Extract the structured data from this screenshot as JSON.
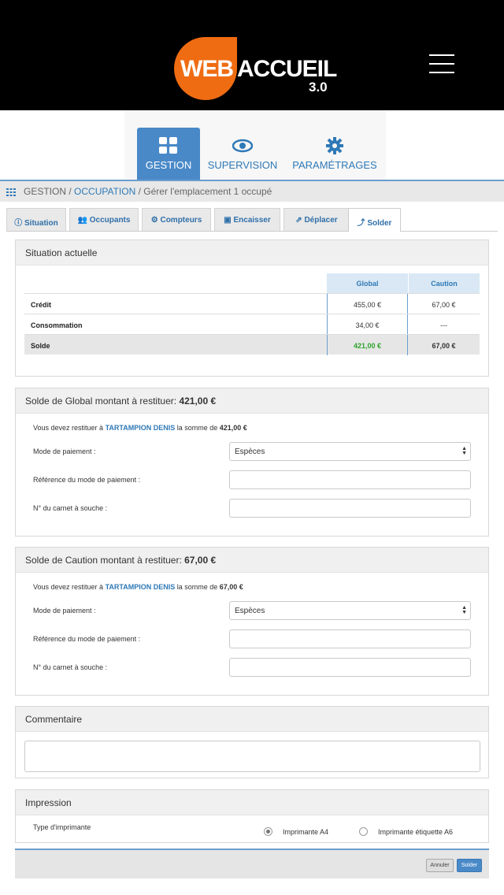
{
  "header": {
    "logo_web": "WEB",
    "logo_accueil": "ACCUEIL",
    "logo_version": "3.0"
  },
  "topnav": {
    "items": [
      {
        "label": "GESTION",
        "icon": "grid-icon",
        "active": true
      },
      {
        "label": "SUPERVISION",
        "icon": "eye-icon",
        "active": false
      },
      {
        "label": "PARAMÉTRAGES",
        "icon": "gear-icon",
        "active": false
      }
    ]
  },
  "breadcrumb": {
    "root": "GESTION",
    "sep1": " / ",
    "section": "OCCUPATION",
    "sep2": " / ",
    "page": "Gérer l'emplacement 1 occupé"
  },
  "tabs": [
    {
      "label": "Situation",
      "icon": "info-icon"
    },
    {
      "label": "Occupants",
      "icon": "users-icon"
    },
    {
      "label": "Compteurs",
      "icon": "cog-icon"
    },
    {
      "label": "Encaisser",
      "icon": "cash-icon"
    },
    {
      "label": "Déplacer",
      "icon": "move-icon"
    },
    {
      "label": "Solder",
      "icon": "arrow-icon",
      "active": true
    }
  ],
  "situation": {
    "title": "Situation actuelle",
    "col_global": "Global",
    "col_caution": "Caution",
    "rows": [
      {
        "label": "Crédit",
        "global": "455,00 €",
        "caution": "67,00 €"
      },
      {
        "label": "Consommation",
        "global": "34,00 €",
        "caution": "---"
      },
      {
        "label": "Solde",
        "global": "421,00 €",
        "caution": "67,00 €"
      }
    ]
  },
  "solde_global": {
    "title_prefix": "Solde de Global montant à restituer: ",
    "title_amount": "421,00 €",
    "msg_prefix": "Vous devez restituer à ",
    "msg_name": "TARTAMPION DENIS",
    "msg_mid": " la somme de ",
    "msg_amount": "421,00 €",
    "mode_label": "Mode de paiement :",
    "mode_value": "Espèces",
    "ref_label": "Référence du mode de paiement :",
    "carnet_label": "N° du carnet à souche :"
  },
  "solde_caution": {
    "title_prefix": "Solde de Caution montant à restituer: ",
    "title_amount": "67,00 €",
    "msg_prefix": "Vous devez restituer à ",
    "msg_name": "TARTAMPION DENIS",
    "msg_mid": " la somme de ",
    "msg_amount": "67,00 €",
    "mode_label": "Mode de paiement :",
    "mode_value": "Espèces",
    "ref_label": "Référence du mode de paiement :",
    "carnet_label": "N° du carnet à souche :"
  },
  "commentaire": {
    "title": "Commentaire"
  },
  "impression": {
    "title": "Impression",
    "type_label": "Type d'imprimante",
    "option_a4": "Imprimante A4",
    "option_a6": "Imprimante étiquette A6",
    "selected": "Imprimante A4"
  },
  "footer": {
    "cancel_label": "Annuler",
    "submit_label": "Solder"
  },
  "colors": {
    "brand_orange": "#ef6c12",
    "accent_blue": "#4a89c8",
    "link_blue": "#2f79b7",
    "positive_green": "#2da52d"
  }
}
